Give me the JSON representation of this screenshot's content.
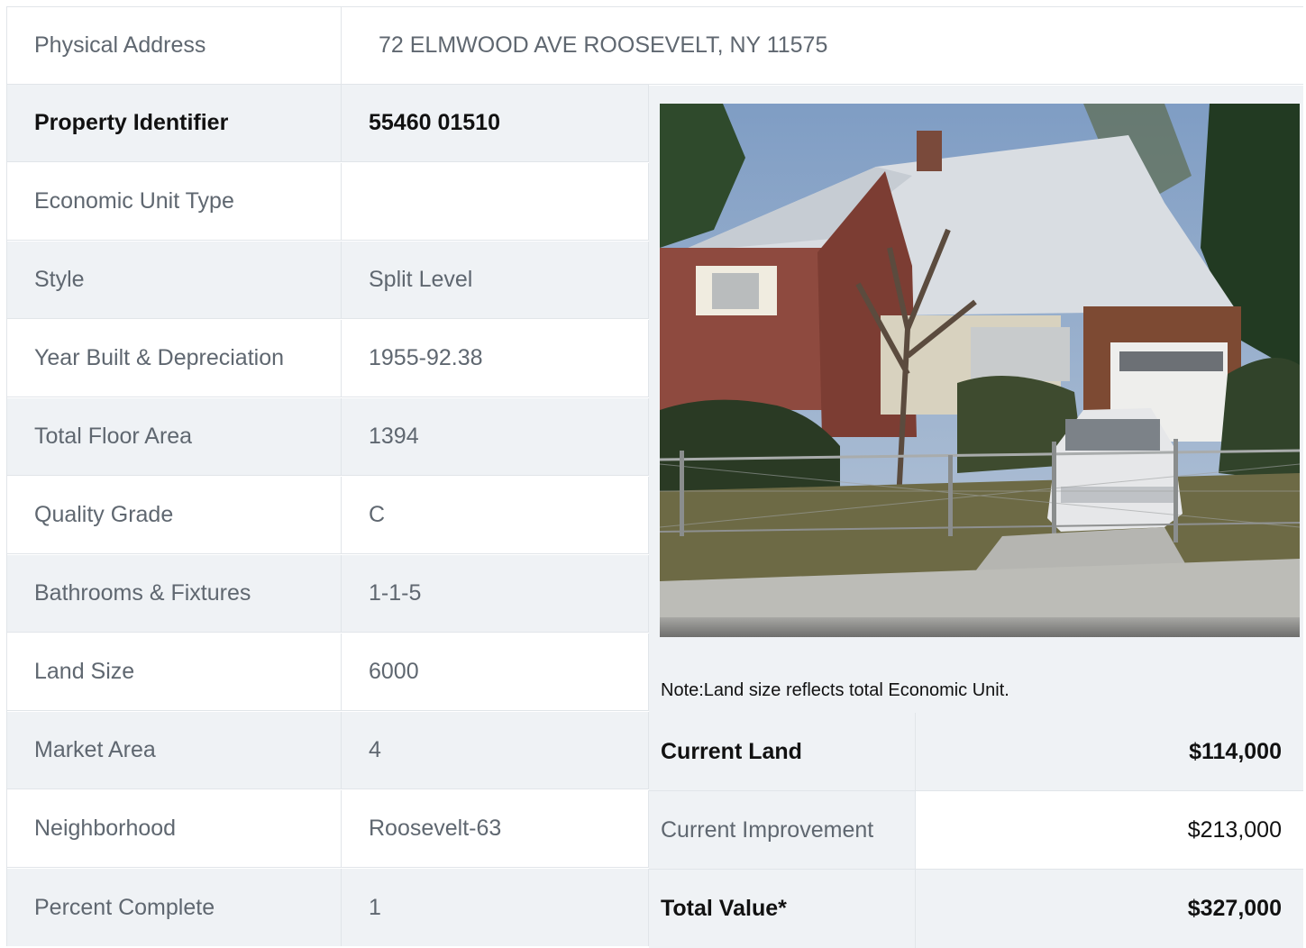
{
  "address": {
    "label": "Physical Address",
    "value": "72  ELMWOOD AVE  ROOSEVELT, NY  11575"
  },
  "details": [
    {
      "label": "Property Identifier",
      "value": "55460  01510"
    },
    {
      "label": "Economic Unit Type",
      "value": ""
    },
    {
      "label": "Style",
      "value": "Split Level"
    },
    {
      "label": "Year Built & Depreciation",
      "value": "1955-92.38"
    },
    {
      "label": "Total Floor Area",
      "value": "1394"
    },
    {
      "label": "Quality Grade",
      "value": "C"
    },
    {
      "label": "Bathrooms & Fixtures",
      "value": "1-1-5"
    },
    {
      "label": "Land Size",
      "value": "6000"
    },
    {
      "label": "Market Area",
      "value": "4"
    },
    {
      "label": "Neighborhood",
      "value": "Roosevelt-63"
    },
    {
      "label": "Percent Complete",
      "value": "1"
    }
  ],
  "note": "Note:Land size reflects total Economic Unit.",
  "values": [
    {
      "label": "Current Land",
      "value": "$114,000"
    },
    {
      "label": "Current Improvement",
      "value": "$213,000"
    },
    {
      "label": "Total Value*",
      "value": "$327,000"
    }
  ],
  "colors": {
    "shade": "#eff2f5",
    "border": "#e1e5e9",
    "text": "#5f6770",
    "strong": "#111111"
  }
}
